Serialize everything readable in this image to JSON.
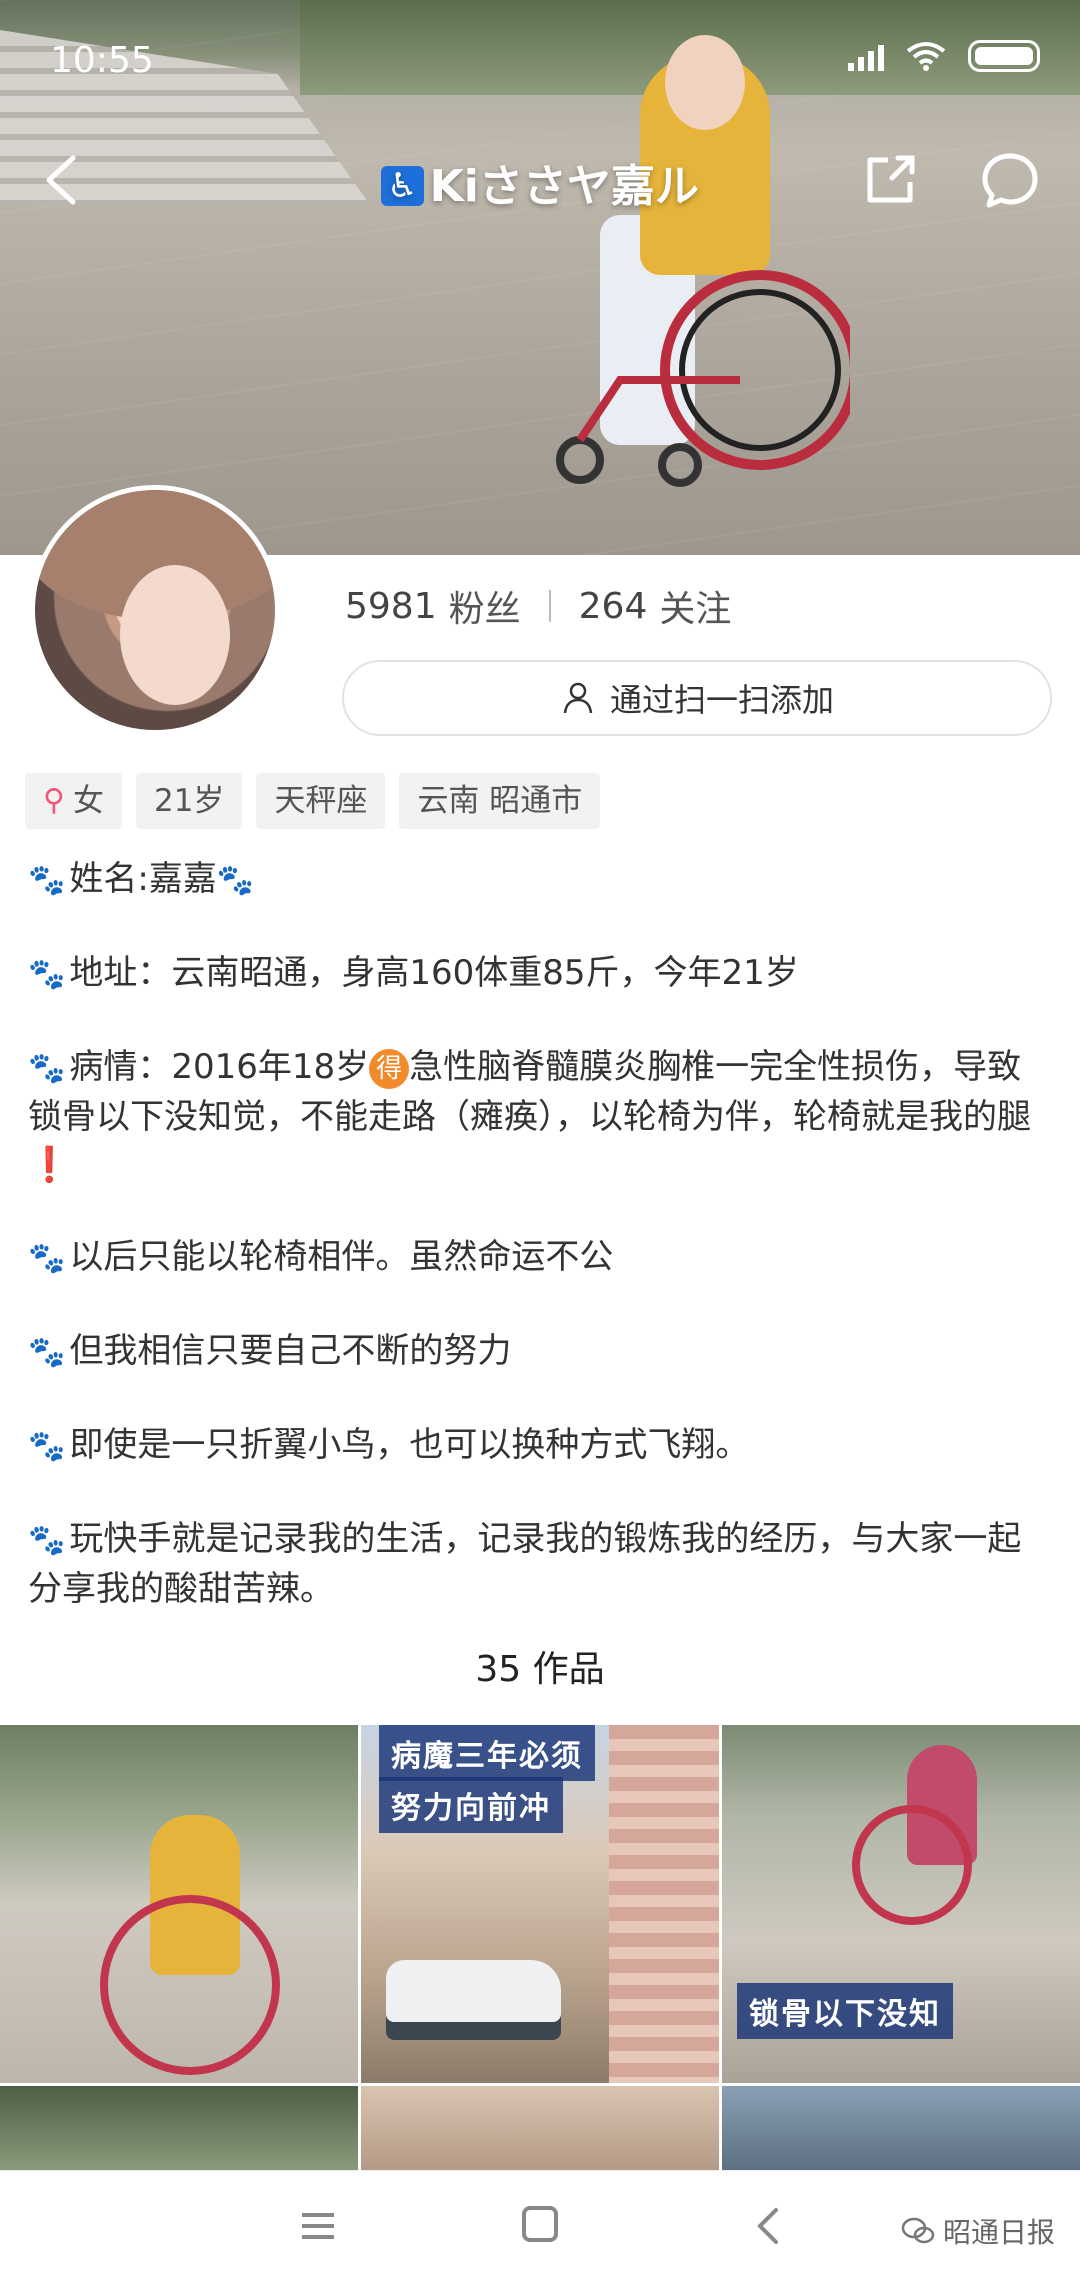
{
  "status_bar": {
    "time": "10:55"
  },
  "nav": {
    "title_badge": "♿",
    "title": "Kiささヤ嘉ル"
  },
  "profile": {
    "followers_count": "5981",
    "followers_label": "粉丝",
    "following_count": "264",
    "following_label": "关注",
    "scan_add_label": "通过扫一扫添加",
    "tags": [
      {
        "icon": "female-icon",
        "text": "女"
      },
      {
        "text": "21岁"
      },
      {
        "text": "天秤座"
      },
      {
        "text": "云南 昭通市"
      }
    ]
  },
  "bio": {
    "line1": "姓名:嘉嘉",
    "line2": "地址：云南昭通，身高160体重85斤，今年21岁",
    "line3_a": "病情：2016年18岁",
    "line3_badge": "得",
    "line3_b": "急性脑脊髓膜炎胸椎一完全性损伤，导致锁骨以下没知觉，不能走路（瘫痪），以轮椅为伴，轮椅就是我的腿",
    "line3_excl": "❗",
    "line4": "以后只能以轮椅相伴。虽然命运不公",
    "line5": "但我相信只要自己不断的努力",
    "line6": "即使是一只折翼小鸟，也可以换种方式飞翔。",
    "line7": "玩快手就是记录我的生活，记录我的锻炼我的经历，与大家一起分享我的酸甜苦辣。"
  },
  "works": {
    "count_label": "35 作品",
    "captions": {
      "item2_top": "病魔三年必须",
      "item2_bottom": "努力向前冲",
      "item3": "锁骨以下没知"
    }
  },
  "navbar": {
    "watermark": "昭通日报"
  },
  "colors": {
    "accent_badge": "#1e6fd9",
    "paw": "#c0392b",
    "caption_bg": "#183478",
    "female": "#f0587a"
  }
}
